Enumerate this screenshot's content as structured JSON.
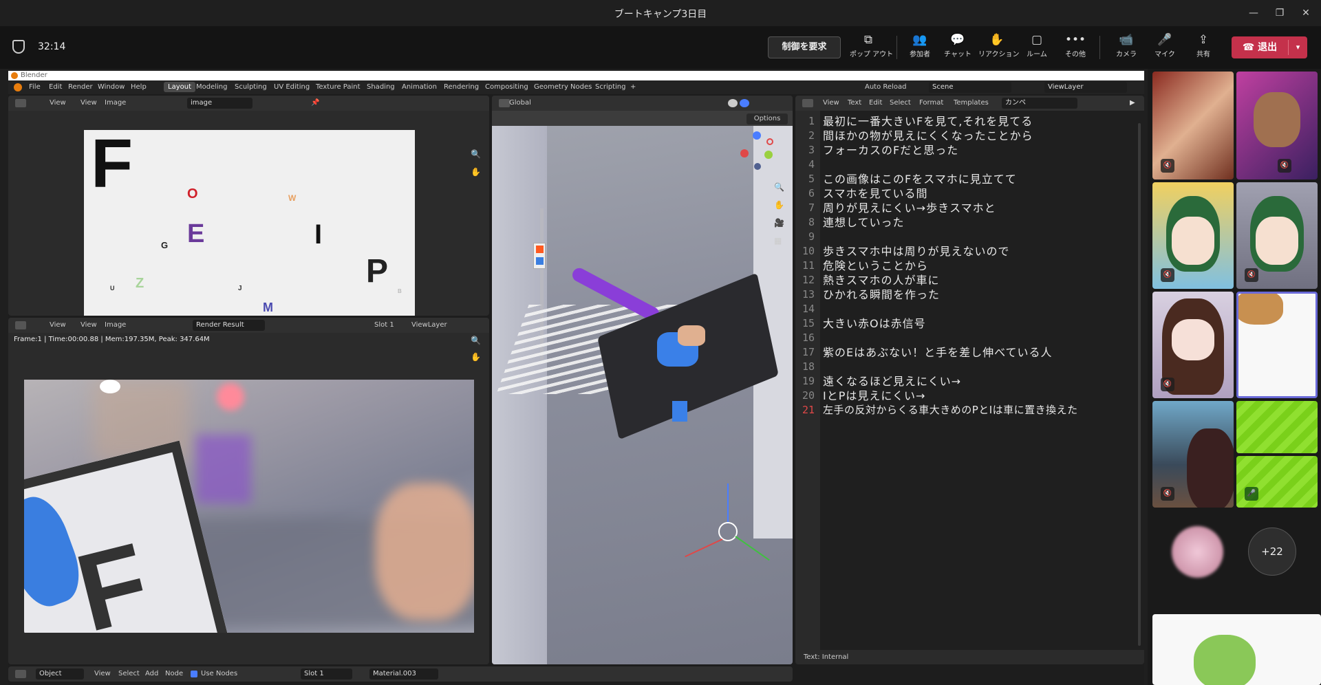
{
  "window": {
    "title": "ブートキャンプ3日目",
    "minimize": "—",
    "restore": "❐",
    "close": "✕"
  },
  "meeting": {
    "timer": "32:14",
    "request_control": "制御を要求",
    "toolbar": [
      {
        "icon": "popout-icon",
        "glyph": "⧉",
        "label": "ポップ アウト"
      },
      {
        "icon": "people-icon",
        "glyph": "👥",
        "label": "参加者"
      },
      {
        "icon": "chat-icon",
        "glyph": "💬",
        "label": "チャット"
      },
      {
        "icon": "reaction-icon",
        "glyph": "✋",
        "label": "リアクション"
      },
      {
        "icon": "room-icon",
        "glyph": "▢",
        "label": "ルーム"
      },
      {
        "icon": "more-icon",
        "glyph": "•••",
        "label": "その他"
      },
      {
        "icon": "camera-icon",
        "glyph": "📹",
        "label": "カメラ"
      },
      {
        "icon": "mic-icon",
        "glyph": "🎤",
        "label": "マイク"
      },
      {
        "icon": "share-icon",
        "glyph": "⇪",
        "label": "共有"
      }
    ],
    "leave": "退出",
    "extra_count": "+22"
  },
  "blender": {
    "app_title": "Blender",
    "menu": [
      "File",
      "Edit",
      "Render",
      "Window",
      "Help"
    ],
    "workspaces": [
      "Layout",
      "Modeling",
      "Sculpting",
      "UV Editing",
      "Texture Paint",
      "Shading",
      "Animation",
      "Rendering",
      "Compositing",
      "Geometry Nodes",
      "Scripting",
      "+"
    ],
    "auto_reload": "Auto Reload",
    "scene": "Scene",
    "view_layer": "ViewLayer",
    "image_editor": {
      "view": "View",
      "image": "Image",
      "image_name": "image"
    },
    "poster_letters": [
      "F",
      "O",
      "W",
      "E",
      "G",
      "I",
      "P",
      "Z",
      "U",
      "J",
      "M",
      "B"
    ],
    "render_editor": {
      "view": "View",
      "image": "Image",
      "name": "Render Result",
      "slot": "Slot 1",
      "layer": "ViewLayer",
      "info": "Frame:1 | Time:00:00.88 | Mem:197.35M, Peak: 347.64M"
    },
    "viewport": {
      "orientation": "Global",
      "options": "Options"
    },
    "text_editor": {
      "menu": [
        "View",
        "Text",
        "Edit",
        "Select",
        "Format",
        "Templates"
      ],
      "file": "カンペ",
      "status": "Text: Internal",
      "lines": [
        "最初に一番大きいFを見て,それを見てる",
        "間ほかの物が見えにくくなったことから",
        "フォーカスのFだと思った",
        "",
        "この画像はこのFをスマホに見立てて",
        "スマホを見ている間",
        "周りが見えにくい→歩きスマホと",
        "連想していった",
        "",
        "歩きスマホ中は周りが見えないので",
        "危険ということから",
        "熱きスマホの人が車に",
        "ひかれる瞬間を作った",
        "",
        "大きい赤Oは赤信号",
        "",
        "紫のEはあぶない！と手を差し伸べている人",
        "",
        "遠くなるほど見えにくい→",
        "IとPは見えにくい→",
        "左手の反対からくる車大きめのPとIは車に置き換えた"
      ]
    },
    "node_bar": {
      "mode": "Object",
      "view": "View",
      "select": "Select",
      "add": "Add",
      "node": "Node",
      "use_nodes": "Use Nodes",
      "slot": "Slot 1",
      "material": "Material.003"
    }
  },
  "colors": {
    "leave_red": "#c4314b",
    "letter_red": "#d0202a",
    "letter_purple": "#6a3a9a",
    "letter_green": "#a8d49a",
    "letter_orange": "#e8a060",
    "letter_blue": "#4a4ab0"
  }
}
